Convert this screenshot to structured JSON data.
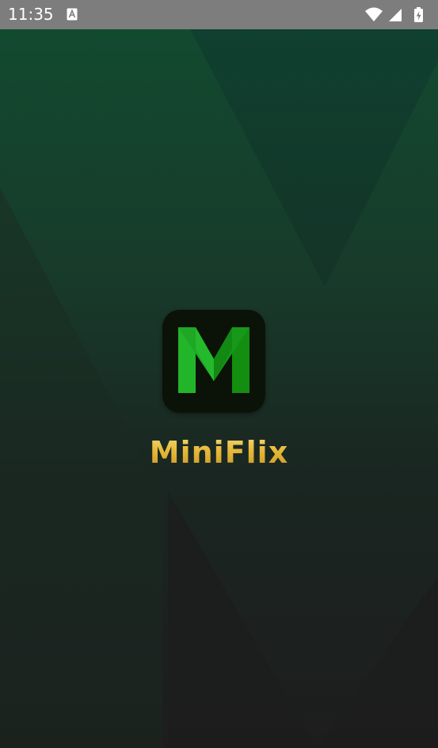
{
  "status_bar": {
    "time": "11:35",
    "notification_icon": "a-icon",
    "wifi_icon": "wifi-icon",
    "signal_icon": "cell-signal-icon",
    "battery_icon": "battery-charging-icon"
  },
  "splash": {
    "app_name": "MiniFlix",
    "logo_letter": "M",
    "logo_icon": "miniflix-logo-icon"
  },
  "colors": {
    "status_bar": "#7d7d7d",
    "bg_top": "#124a30",
    "bg_bottom": "#1d1d1d",
    "logo_green": "#22b52a",
    "logo_dark_green": "#138e10",
    "logo_tile": "#0b1208",
    "brand_gold": "#e6b93a"
  }
}
